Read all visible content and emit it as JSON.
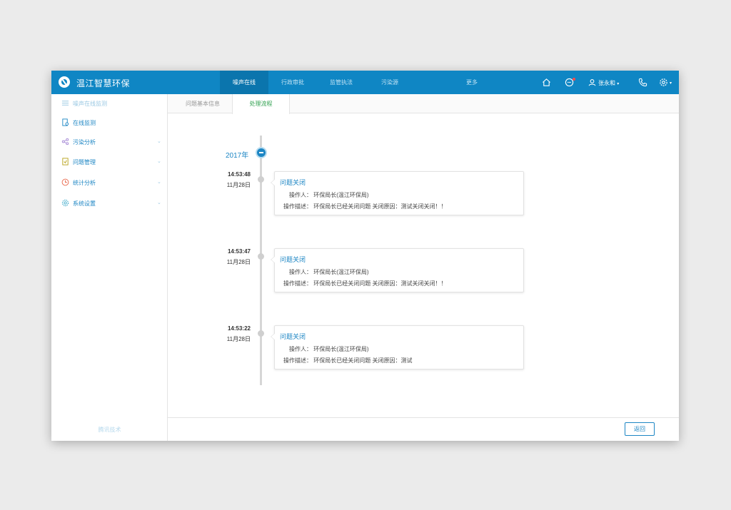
{
  "app": {
    "title": "温江智慧环保"
  },
  "topnav": {
    "tabs": [
      {
        "label": "噪声在线",
        "active": true
      },
      {
        "label": "行政审批",
        "active": false
      },
      {
        "label": "监管执法",
        "active": false
      },
      {
        "label": "污染源",
        "active": false
      },
      {
        "label": "更多",
        "active": false
      }
    ],
    "user": {
      "name": "张永和",
      "caret": "▾"
    },
    "icons": [
      "home-icon",
      "message-icon",
      "user-icon",
      "phone-icon",
      "settings-icon"
    ],
    "settings_caret": "▾"
  },
  "sidebar": {
    "items": [
      {
        "label": "噪声在线监测",
        "icon": "menu-icon",
        "muted": true
      },
      {
        "label": "在线监测",
        "icon": "monitor-icon"
      },
      {
        "label": "污染分析",
        "icon": "share-icon",
        "chevron": "⌄"
      },
      {
        "label": "问题管理",
        "icon": "document-icon",
        "chevron": "⌄"
      },
      {
        "label": "统计分析",
        "icon": "clock-icon",
        "chevron": "⌄"
      },
      {
        "label": "系统设置",
        "icon": "gear-icon",
        "chevron": "⌄"
      }
    ],
    "footer": "腾讯技术"
  },
  "content_tabs": [
    {
      "label": "问题基本信息",
      "active": false
    },
    {
      "label": "处理流程",
      "active": true
    }
  ],
  "timeline": {
    "year": "2017年",
    "entries": [
      {
        "time": "14:53:48",
        "date": "11月28日",
        "title": "问题关闭",
        "operator_label": "操作人：",
        "operator": "环保局长(温江环保局)",
        "desc_label": "操作描述：",
        "desc": "环保局长已经关闭问题 关闭原因：测试关闭关闭！！"
      },
      {
        "time": "14:53:47",
        "date": "11月28日",
        "title": "问题关闭",
        "operator_label": "操作人：",
        "operator": "环保局长(温江环保局)",
        "desc_label": "操作描述：",
        "desc": "环保局长已经关闭问题 关闭原因：测试关闭关闭！！"
      },
      {
        "time": "14:53:22",
        "date": "11月28日",
        "title": "问题关闭",
        "operator_label": "操作人：",
        "operator": "环保局长(温江环保局)",
        "desc_label": "操作描述：",
        "desc": "环保局长已经关闭问题 关闭原因：测试"
      }
    ]
  },
  "footer": {
    "back_label": "返回"
  },
  "colors": {
    "primary": "#0f86c4",
    "active_tab": "#2fa04f",
    "accent": "#1d86c4"
  }
}
